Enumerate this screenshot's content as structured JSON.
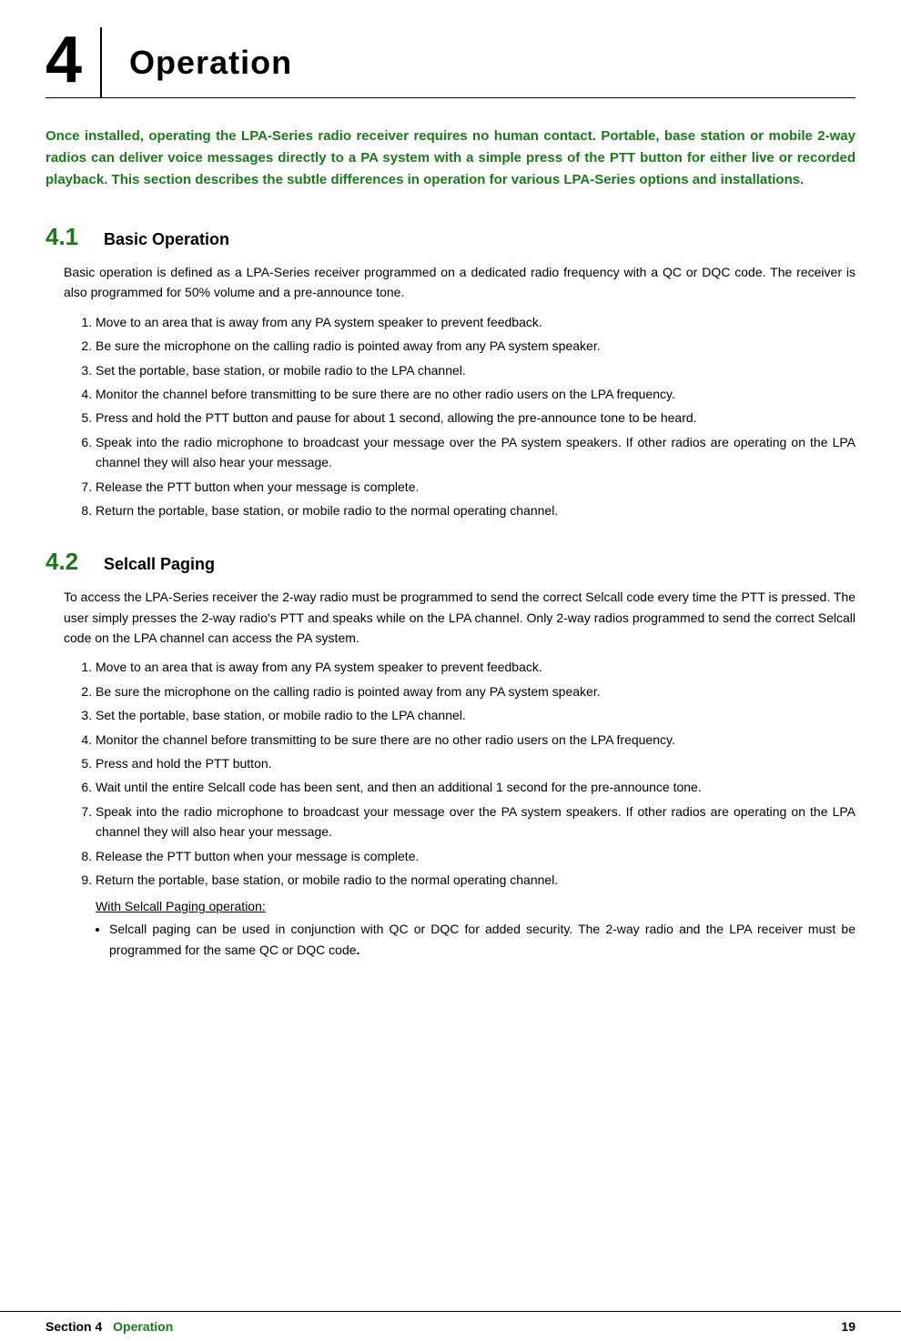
{
  "header": {
    "section_number": "4",
    "title": "Operation"
  },
  "intro": {
    "text": "Once installed, operating the LPA-Series radio receiver requires no human contact. Portable, base station or mobile 2-way radios can deliver voice messages directly to a PA system with a simple press of the PTT button for either live or recorded playback.  This section describes the subtle differences in operation for various LPA-Series options and installations."
  },
  "sections": [
    {
      "number": "4.1",
      "title": "Basic Operation",
      "intro": "Basic operation is defined as a LPA-Series receiver programmed on a dedicated radio frequency with a QC or DQC code.  The receiver is also programmed for 50% volume and a pre-announce tone.",
      "steps": [
        "Move to an area that is away from any PA system speaker to prevent feedback.",
        "Be sure the microphone on the calling radio is pointed away from any PA system speaker.",
        "Set the portable, base station, or mobile radio to the LPA channel.",
        "Monitor the channel before transmitting to be sure there are no other radio users on the LPA frequency.",
        "Press and hold the PTT button and pause for about 1 second, allowing the pre-announce tone to be heard.",
        "Speak into the radio microphone to broadcast your message over the PA system speakers.  If other radios are operating on the LPA channel they will also hear your message.",
        "Release the PTT button when your message is complete.",
        "Return the portable, base station, or mobile radio to the normal operating channel."
      ],
      "subheading": null,
      "bullets": []
    },
    {
      "number": "4.2",
      "title": "Selcall Paging",
      "intro": "To access the LPA-Series receiver the 2-way radio must be programmed to send the correct Selcall code every time the PTT is pressed.  The user simply presses the 2-way radio's PTT and speaks while on the LPA channel.  Only 2-way radios programmed to send the correct Selcall code on the LPA channel can access the PA system.",
      "steps": [
        "Move to an area that is away from any PA system speaker to prevent feedback.",
        "Be sure the microphone on the calling radio is pointed away from any PA system speaker.",
        "Set the portable, base station, or mobile radio to the LPA channel.",
        "Monitor the channel before transmitting to be sure there are no other radio users on the LPA frequency.",
        "Press and hold the PTT button.",
        "Wait until the entire Selcall code has been sent, and then an additional 1 second for the pre-announce tone.",
        "Speak into the radio microphone to broadcast your message over the PA system speakers.  If other radios are operating on the LPA channel they will also hear your message.",
        "Release the PTT button when your message is complete.",
        "Return the portable, base station, or mobile radio to the normal operating channel."
      ],
      "subheading": "With Selcall Paging operation:",
      "bullets": [
        {
          "text_normal": "Selcall paging can be used in conjunction with QC or DQC for added security.  The 2-way radio and the LPA receiver must be programmed for the same QC or DQC code",
          "text_bold": "."
        }
      ]
    }
  ],
  "footer": {
    "left_label": "Section 4",
    "left_value": "Operation",
    "right_value": "19"
  }
}
